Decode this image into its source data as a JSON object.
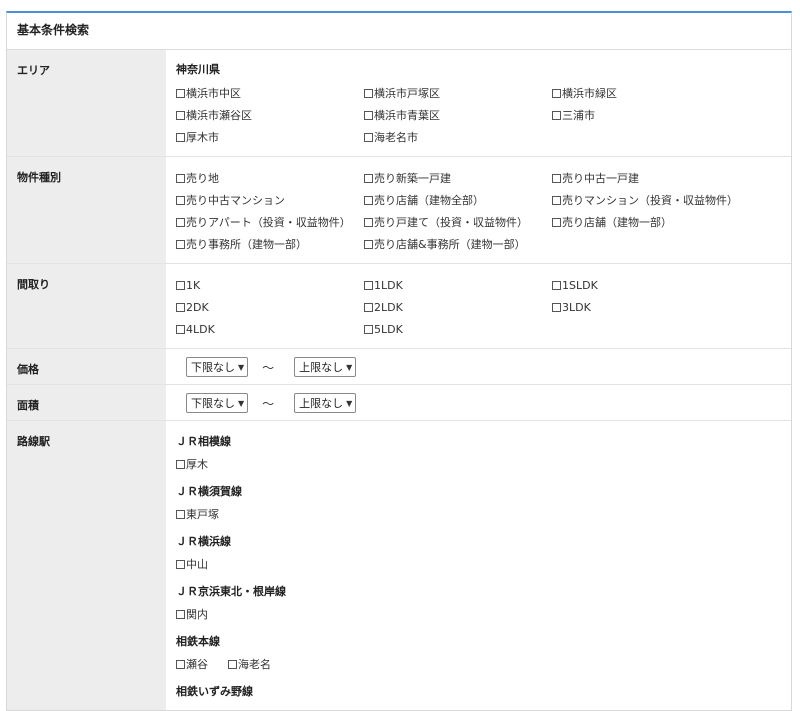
{
  "title": "基本条件検索",
  "area": {
    "label": "エリア",
    "prefecture": "神奈川県",
    "items": [
      "横浜市中区",
      "横浜市戸塚区",
      "横浜市緑区",
      "横浜市瀬谷区",
      "横浜市青葉区",
      "三浦市",
      "厚木市",
      "海老名市"
    ]
  },
  "property_type": {
    "label": "物件種別",
    "items": [
      "売り地",
      "売り新築一戸建",
      "売り中古一戸建",
      "売り中古マンション",
      "売り店舗（建物全部）",
      "売りマンション（投資・収益物件）",
      "売りアパート（投資・収益物件）",
      "売り戸建て（投資・収益物件）",
      "売り店舗（建物一部）",
      "売り事務所（建物一部）",
      "売り店舗&事務所（建物一部）"
    ]
  },
  "layout": {
    "label": "間取り",
    "items": [
      "1K",
      "1LDK",
      "1SLDK",
      "2DK",
      "2LDK",
      "3LDK",
      "4LDK",
      "5LDK"
    ]
  },
  "price": {
    "label": "価格",
    "min": "下限なし",
    "max": "上限なし",
    "separator": "～"
  },
  "area_size": {
    "label": "面積",
    "min": "下限なし",
    "max": "上限なし",
    "separator": "～"
  },
  "rail": {
    "label": "路線駅",
    "lines": [
      {
        "name": "ＪＲ相模線",
        "stations": [
          "厚木"
        ]
      },
      {
        "name": "ＪＲ横須賀線",
        "stations": [
          "東戸塚"
        ]
      },
      {
        "name": "ＪＲ横浜線",
        "stations": [
          "中山"
        ]
      },
      {
        "name": "ＪＲ京浜東北・根岸線",
        "stations": [
          "関内"
        ]
      },
      {
        "name": "相鉄本線",
        "stations": [
          "瀬谷",
          "海老名"
        ]
      },
      {
        "name": "相鉄いずみ野線",
        "stations": []
      }
    ]
  },
  "colors": {
    "accent": "#4a90d9",
    "label_bg": "#ededed"
  }
}
